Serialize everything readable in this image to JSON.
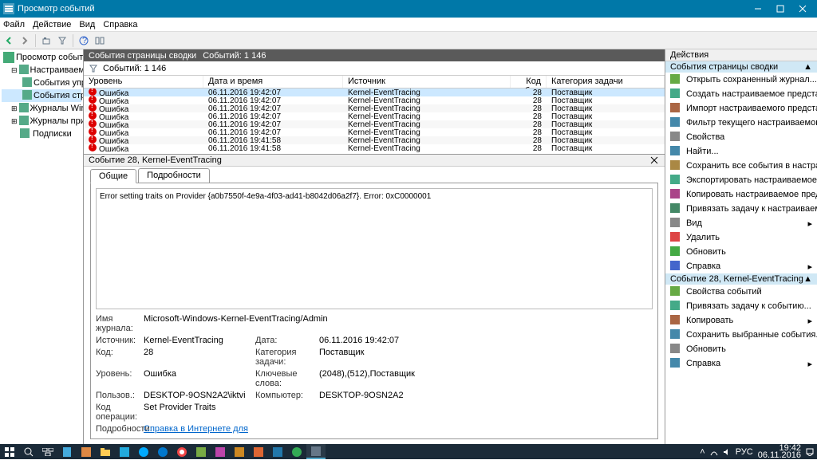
{
  "window": {
    "title": "Просмотр событий"
  },
  "menu": [
    "Файл",
    "Действие",
    "Вид",
    "Справка"
  ],
  "tree": {
    "root": "Просмотр событий (Локальн",
    "items": [
      {
        "label": "Настраиваемые представле",
        "lvl": 1,
        "exp": "-"
      },
      {
        "label": "События управления",
        "lvl": 2
      },
      {
        "label": "События страницы сво",
        "lvl": 2,
        "sel": true
      },
      {
        "label": "Журналы Windows",
        "lvl": 1,
        "exp": "+"
      },
      {
        "label": "Журналы приложений и сл",
        "lvl": 1,
        "exp": "+"
      },
      {
        "label": "Подписки",
        "lvl": 1
      }
    ]
  },
  "center": {
    "header_title": "События страницы сводки",
    "header_count": "Событий: 1 146",
    "filter_count": "Событий: 1 146",
    "columns": [
      "Уровень",
      "Дата и время",
      "Источник",
      "Код события",
      "Категория задачи"
    ],
    "rows": [
      {
        "lvl": "Ошибка",
        "dt": "06.11.2016 19:42:07",
        "src": "Kernel-EventTracing",
        "id": "28",
        "cat": "Поставщик",
        "sel": true
      },
      {
        "lvl": "Ошибка",
        "dt": "06.11.2016 19:42:07",
        "src": "Kernel-EventTracing",
        "id": "28",
        "cat": "Поставщик"
      },
      {
        "lvl": "Ошибка",
        "dt": "06.11.2016 19:42:07",
        "src": "Kernel-EventTracing",
        "id": "28",
        "cat": "Поставщик"
      },
      {
        "lvl": "Ошибка",
        "dt": "06.11.2016 19:42:07",
        "src": "Kernel-EventTracing",
        "id": "28",
        "cat": "Поставщик"
      },
      {
        "lvl": "Ошибка",
        "dt": "06.11.2016 19:42:07",
        "src": "Kernel-EventTracing",
        "id": "28",
        "cat": "Поставщик"
      },
      {
        "lvl": "Ошибка",
        "dt": "06.11.2016 19:42:07",
        "src": "Kernel-EventTracing",
        "id": "28",
        "cat": "Поставщик"
      },
      {
        "lvl": "Ошибка",
        "dt": "06.11.2016 19:41:58",
        "src": "Kernel-EventTracing",
        "id": "28",
        "cat": "Поставщик"
      },
      {
        "lvl": "Ошибка",
        "dt": "06.11.2016 19:41:58",
        "src": "Kernel-EventTracing",
        "id": "28",
        "cat": "Поставщик"
      }
    ]
  },
  "detail": {
    "title": "Событие 28, Kernel-EventTracing",
    "tabs": [
      "Общие",
      "Подробности"
    ],
    "message": "Error setting traits on Provider {a0b7550f-4e9a-4f03-ad41-b8042d06a2f7}. Error: 0xC0000001",
    "props": {
      "log_label": "Имя журнала:",
      "log": "Microsoft-Windows-Kernel-EventTracing/Admin",
      "src_label": "Источник:",
      "src": "Kernel-EventTracing",
      "date_label": "Дата:",
      "date": "06.11.2016 19:42:07",
      "code_label": "Код:",
      "code": "28",
      "cat_label": "Категория задачи:",
      "cat": "Поставщик",
      "lvl_label": "Уровень:",
      "lvl": "Ошибка",
      "kw_label": "Ключевые слова:",
      "kw": "(2048),(512),Поставщик",
      "user_label": "Пользов.:",
      "user": "DESKTOP-9OSN2A2\\iktvi",
      "comp_label": "Компьютер:",
      "comp": "DESKTOP-9OSN2A2",
      "op_label": "Код операции:",
      "op": "Set Provider Traits",
      "more_label": "Подробности:",
      "more": "Справка в Интернете для "
    }
  },
  "actions": {
    "header": "Действия",
    "section1": "События страницы сводки",
    "items1": [
      "Открыть сохраненный журнал...",
      "Создать настраиваемое представление...",
      "Импорт настраиваемого представления...",
      "Фильтр текущего настраиваемого представления...",
      "Свойства",
      "Найти...",
      "Сохранить все события в настраиваемом представл...",
      "Экспортировать настраиваемое представление...",
      "Копировать настраиваемое представление...",
      "Привязать задачу к настраиваемому представлени...",
      "Вид",
      "Удалить",
      "Обновить",
      "Справка"
    ],
    "section2": "Событие 28, Kernel-EventTracing",
    "items2": [
      "Свойства событий",
      "Привязать задачу к событию...",
      "Копировать",
      "Сохранить выбранные события...",
      "Обновить",
      "Справка"
    ]
  },
  "taskbar": {
    "time": "19:42",
    "date": "06.11.2016",
    "lang": "РУС"
  }
}
